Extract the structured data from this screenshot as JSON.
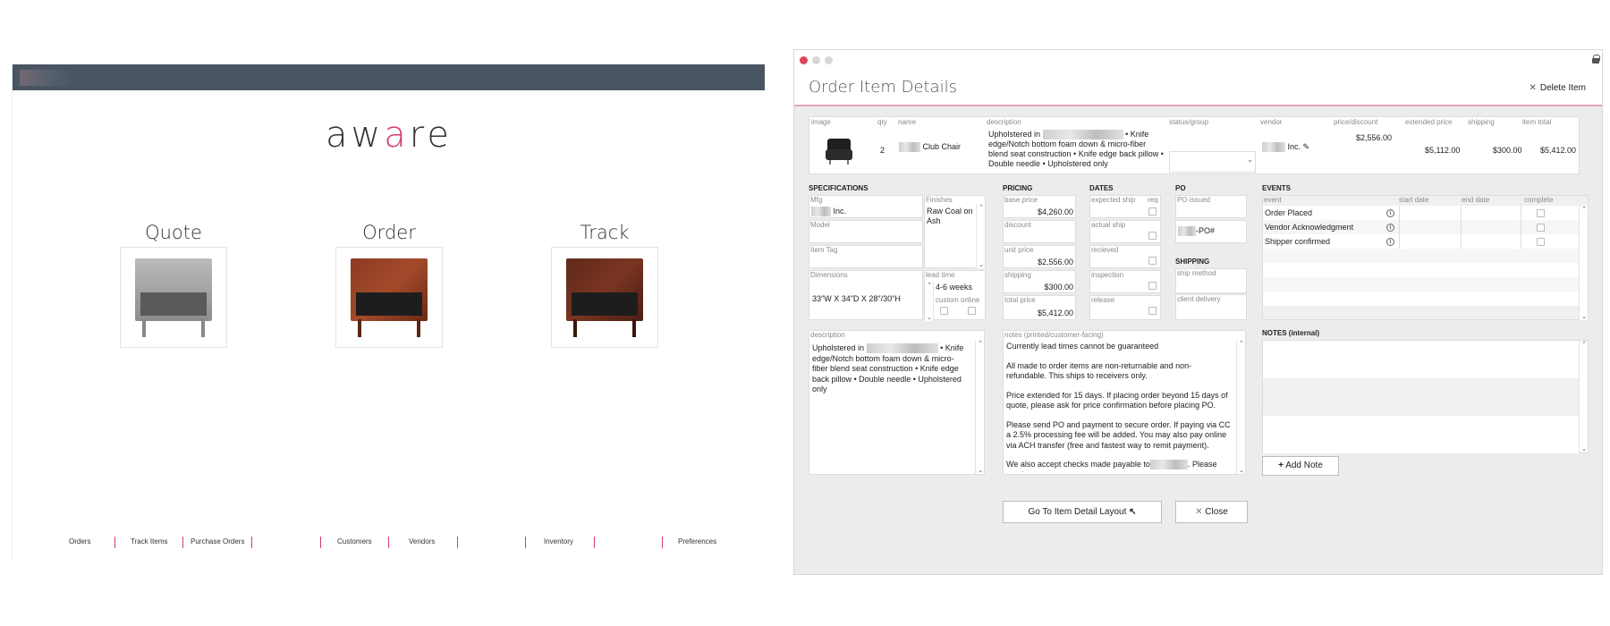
{
  "app": {
    "brand_prefix": "aw",
    "brand_accent": "a",
    "brand_suffix": "re",
    "accent_color": "#d63a6b",
    "topbar_color": "#4a5563",
    "modules": [
      {
        "title": "Quote",
        "image": "grey-nightstand"
      },
      {
        "title": "Order",
        "image": "walnut-nightstand"
      },
      {
        "title": "Track",
        "image": "dark-walnut-nightstand"
      }
    ],
    "nav": [
      "Orders",
      "Track Items",
      "Purchase Orders",
      "Customers",
      "Vendors",
      "Inventory",
      "Preferences"
    ]
  },
  "window": {
    "title": "Order Item Details",
    "delete_label": "Delete Item",
    "item": {
      "headers": {
        "image": "image",
        "qty": "qty",
        "name": "name",
        "description": "description",
        "status": "status/group",
        "vendor": "vendor",
        "price": "price/discount",
        "extended": "extended price",
        "shipping": "shipping",
        "total": "item total"
      },
      "qty": "2",
      "name": "Club Chair",
      "description_suffix": "• Knife edge/Notch bottom foam down & micro-fiber blend seat construction • Knife edge back pillow • Double needle • Upholstered only",
      "description_prefix": "Upholstered in",
      "vendor_suffix": "Inc.",
      "price": "$2,556.00",
      "extended": "$5,112.00",
      "shipping": "$300.00",
      "total": "$5,412.00"
    },
    "specs": {
      "title": "SPECIFICATIONS",
      "mfg_label": "Mfg",
      "mfg_suffix": "Inc.",
      "finishes_label": "Finishes",
      "finishes_value": "Raw Coal on Ash",
      "model_label": "Model",
      "tag_label": "Item Tag",
      "dimensions_label": "Dimensions",
      "dimensions_value": "33\"W X 34\"D X 28\"/30\"H",
      "lead_label": "lead time",
      "lead_value": "4-6 weeks",
      "custom_label": "custom",
      "online_label": "online"
    },
    "pricing": {
      "title": "PRICING",
      "base_label": "base price",
      "base_value": "$4,260.00",
      "discount_label": "discount",
      "unit_label": "unit price",
      "unit_value": "$2,556.00",
      "shipping_label": "shipping",
      "shipping_value": "$300.00",
      "total_label": "total price",
      "total_value": "$5,412.00"
    },
    "dates": {
      "title": "DATES",
      "expected_label": "expected ship",
      "req_label": "req",
      "actual_label": "actual ship",
      "received_label": "recieved",
      "inspection_label": "inspection",
      "release_label": "release"
    },
    "po": {
      "title": "PO",
      "issued_label": "PO issued",
      "po_number_suffix": "-PO#"
    },
    "shipping_sec": {
      "title": "SHIPPING",
      "method_label": "ship method",
      "client_label": "client delivery"
    },
    "events": {
      "title": "EVENTS",
      "headers": {
        "event": "event",
        "start": "start date",
        "end": "end date",
        "complete": "complete"
      },
      "rows": [
        "Order Placed",
        "Vendor Acknowledgment",
        "Shipper confirmed"
      ]
    },
    "description_box": {
      "label": "description",
      "prefix": "Upholstered in",
      "suffix": "• Knife edge/Notch bottom foam down & micro-fiber blend seat construction • Knife edge back pillow • Double needle • Upholstered only"
    },
    "notes_printed": {
      "label": "notes (printed/customer-facing)",
      "paragraphs": [
        "Currently lead times cannot be guaranteed",
        "All made to order items are non-returnable and non- refundable. This ships to receivers only.",
        "Price extended for 15 days. If placing order beyond 15 days of quote, please ask for price confirmation before placing PO.",
        "Please send PO and payment to secure order. If paying via CC a 2.5% processing fee will be added. You may also pay online via ACH transfer (free and fastest way to remit payment)."
      ],
      "last_prefix": "We also accept checks made payable to",
      "last_suffix": "Please send"
    },
    "notes_internal": {
      "title": "NOTES (internal)",
      "add_label": "Add Note"
    },
    "buttons": {
      "goto": "Go To Item Detail Layout",
      "close": "Close"
    }
  }
}
